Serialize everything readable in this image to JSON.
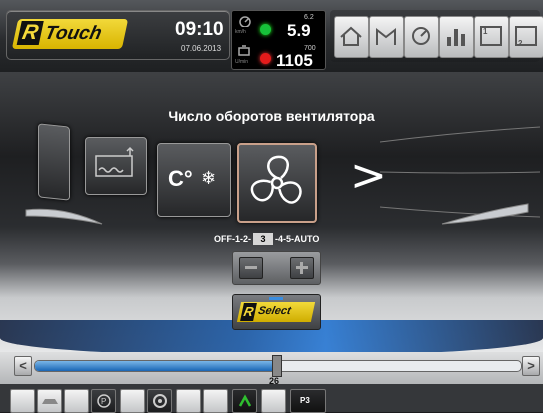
{
  "header": {
    "brand": "Touch",
    "brand_mark": "R",
    "time": "09:10",
    "date": "07.06.2013"
  },
  "status": {
    "top_label": "km/h",
    "top_small": "6.2",
    "top_value": "5.9",
    "top_dot_color": "#17c23a",
    "bottom_label": "U/min",
    "bottom_small": "700",
    "bottom_value": "1105",
    "bottom_dot_color": "#e41b1b"
  },
  "nav": [
    {
      "icon": "home-icon"
    },
    {
      "icon": "machine-icon"
    },
    {
      "icon": "gauge-icon"
    },
    {
      "icon": "bar-chart-icon"
    },
    {
      "icon": "page-1-icon",
      "label": "1"
    },
    {
      "icon": "page-2-icon",
      "label": "2"
    }
  ],
  "main": {
    "title": "Число оборотов вентилятора",
    "carousel_arrow": ">",
    "climate_label": "C°"
  },
  "fan_speed": {
    "prefix": "OFF-1-2-",
    "selected": "3",
    "suffix": "-4-5-AUTO"
  },
  "rselect": {
    "brand_mark": "R",
    "label": "Select"
  },
  "slider": {
    "value": "26",
    "fraction": 0.49,
    "left_arrow": "<",
    "right_arrow": ">"
  },
  "bottom": {
    "p3_label": "P3",
    "accent": "#2fbf2f"
  }
}
